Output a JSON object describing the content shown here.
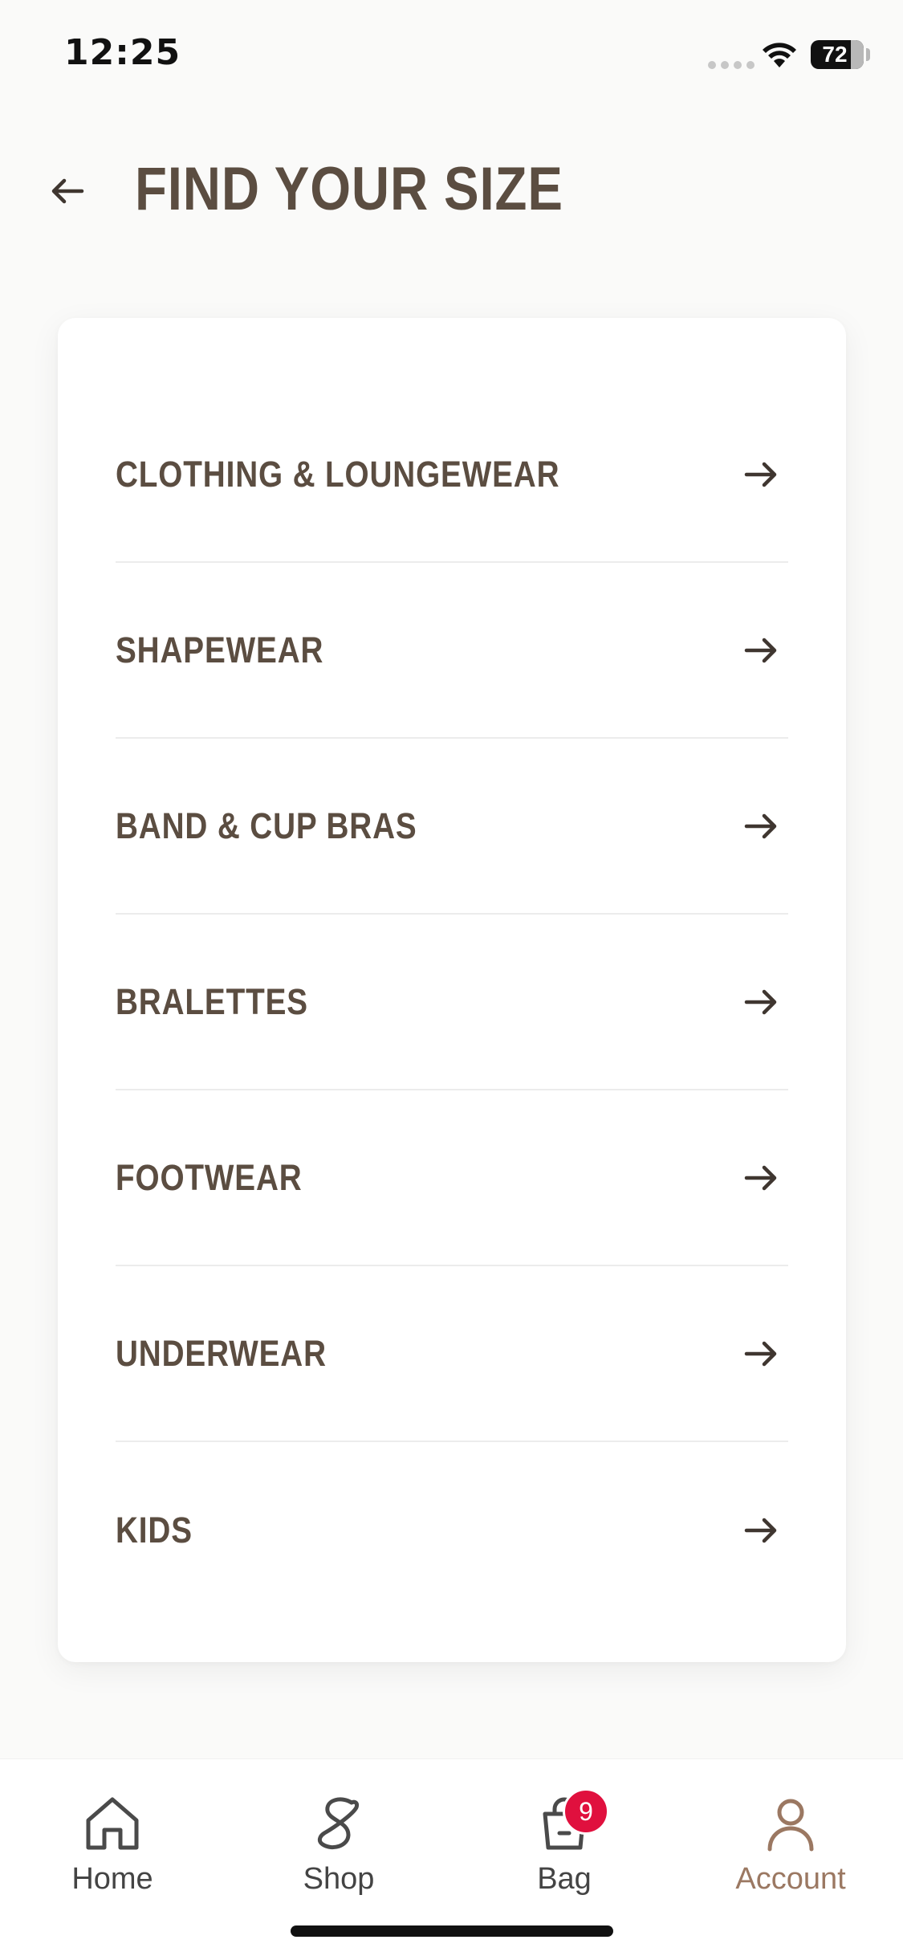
{
  "status_bar": {
    "time": "12:25",
    "battery": "72"
  },
  "header": {
    "title": "FIND YOUR SIZE",
    "back_icon": "arrow-left-icon"
  },
  "size_categories": [
    {
      "label": "CLOTHING & LOUNGEWEAR",
      "icon": "arrow-right-icon"
    },
    {
      "label": "SHAPEWEAR",
      "icon": "arrow-right-icon"
    },
    {
      "label": "BAND & CUP BRAS",
      "icon": "arrow-right-icon"
    },
    {
      "label": "BRALETTES",
      "icon": "arrow-right-icon"
    },
    {
      "label": "FOOTWEAR",
      "icon": "arrow-right-icon"
    },
    {
      "label": "UNDERWEAR",
      "icon": "arrow-right-icon"
    },
    {
      "label": "KIDS",
      "icon": "arrow-right-icon"
    }
  ],
  "tab_bar": {
    "tabs": [
      {
        "label": "Home",
        "icon": "house-icon"
      },
      {
        "label": "Shop",
        "icon": "shop-s-icon"
      },
      {
        "label": "Bag",
        "icon": "shopping-bag-icon",
        "badge": "9"
      },
      {
        "label": "Account",
        "icon": "user-icon",
        "active": true
      }
    ]
  },
  "colors": {
    "text_primary": "#5b4d41",
    "accent_active": "#9b7862",
    "badge": "#e0103e",
    "background": "#fafaf9"
  }
}
